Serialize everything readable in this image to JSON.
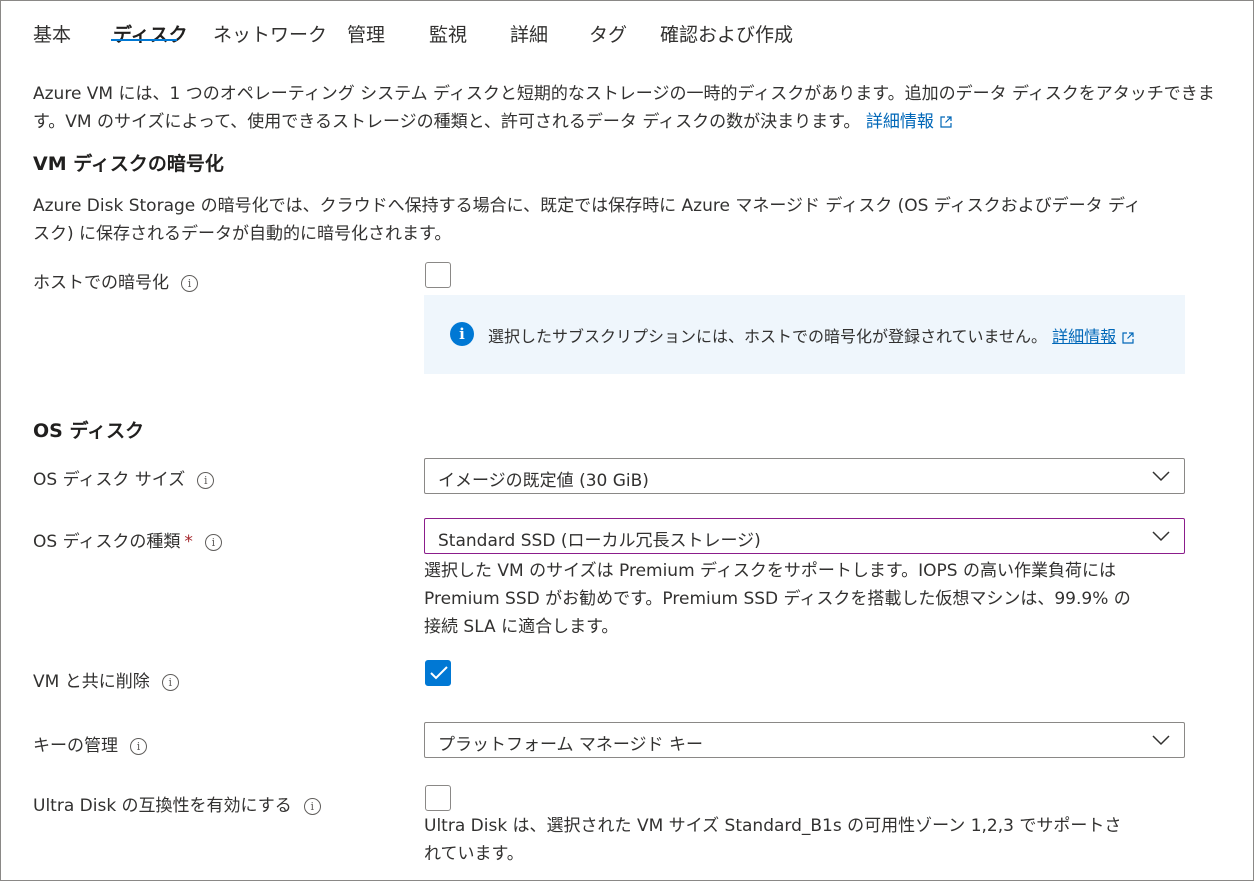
{
  "tabs": [
    "基本",
    "ディスク",
    "ネットワーク",
    "管理",
    "監視",
    "詳細",
    "タグ",
    "確認および作成"
  ],
  "active_tab": "ディスク",
  "intro": {
    "line1": "Azure VM には、1 つのオペレーティング システム ディスクと短期的なストレージの一時的ディスクがあります。追加のデータ ディスクをアタッチできま",
    "line2": "す。VM のサイズによって、使用できるストレージの種類と、許可されるデータ ディスクの数が決まります。",
    "link": "詳細情報"
  },
  "encryption": {
    "heading": "VM ディスクの暗号化",
    "desc_line1": "Azure Disk Storage の暗号化では、クラウドへ保持する場合に、既定では保存時に Azure マネージド ディスク (OS ディスクおよびデータ ディ",
    "desc_line2": "スク) に保存されるデータが自動的に暗号化されます。",
    "host_label": "ホストでの暗号化",
    "host_checked": false,
    "info_text": "選択したサブスクリプションには、ホストでの暗号化が登録されていません。",
    "info_link": "詳細情報"
  },
  "os_disk": {
    "heading": "OS ディスク",
    "size_label": "OS ディスク サイズ",
    "size_value": "イメージの既定値 (30 GiB)",
    "type_label": "OS ディスクの種類",
    "required_mark": "*",
    "type_value": "Standard SSD (ローカル冗長ストレージ)",
    "type_help_line1": "選択した VM のサイズは Premium ディスクをサポートします。IOPS の高い作業負荷には",
    "type_help_line2": "Premium SSD がお勧めです。Premium SSD ディスクを搭載した仮想マシンは、99.9% の",
    "type_help_line3": "接続 SLA に適合します。",
    "delete_label": "VM と共に削除",
    "delete_checked": true,
    "key_label": "キーの管理",
    "key_value": "プラットフォーム マネージド キー",
    "ultra_label": "Ultra Disk の互換性を有効にする",
    "ultra_checked": false,
    "ultra_help_line1": "Ultra Disk は、選択された VM サイズ Standard_B1s の可用性ゾーン 1,2,3 でサポートさ",
    "ultra_help_line2": "れています。"
  },
  "info_glyph": "i",
  "colors": {
    "accent": "#0078d4",
    "link": "#0067b8",
    "info_bg": "#eff6fc",
    "focus_border": "#8b1d8b",
    "required": "#a4262c"
  }
}
